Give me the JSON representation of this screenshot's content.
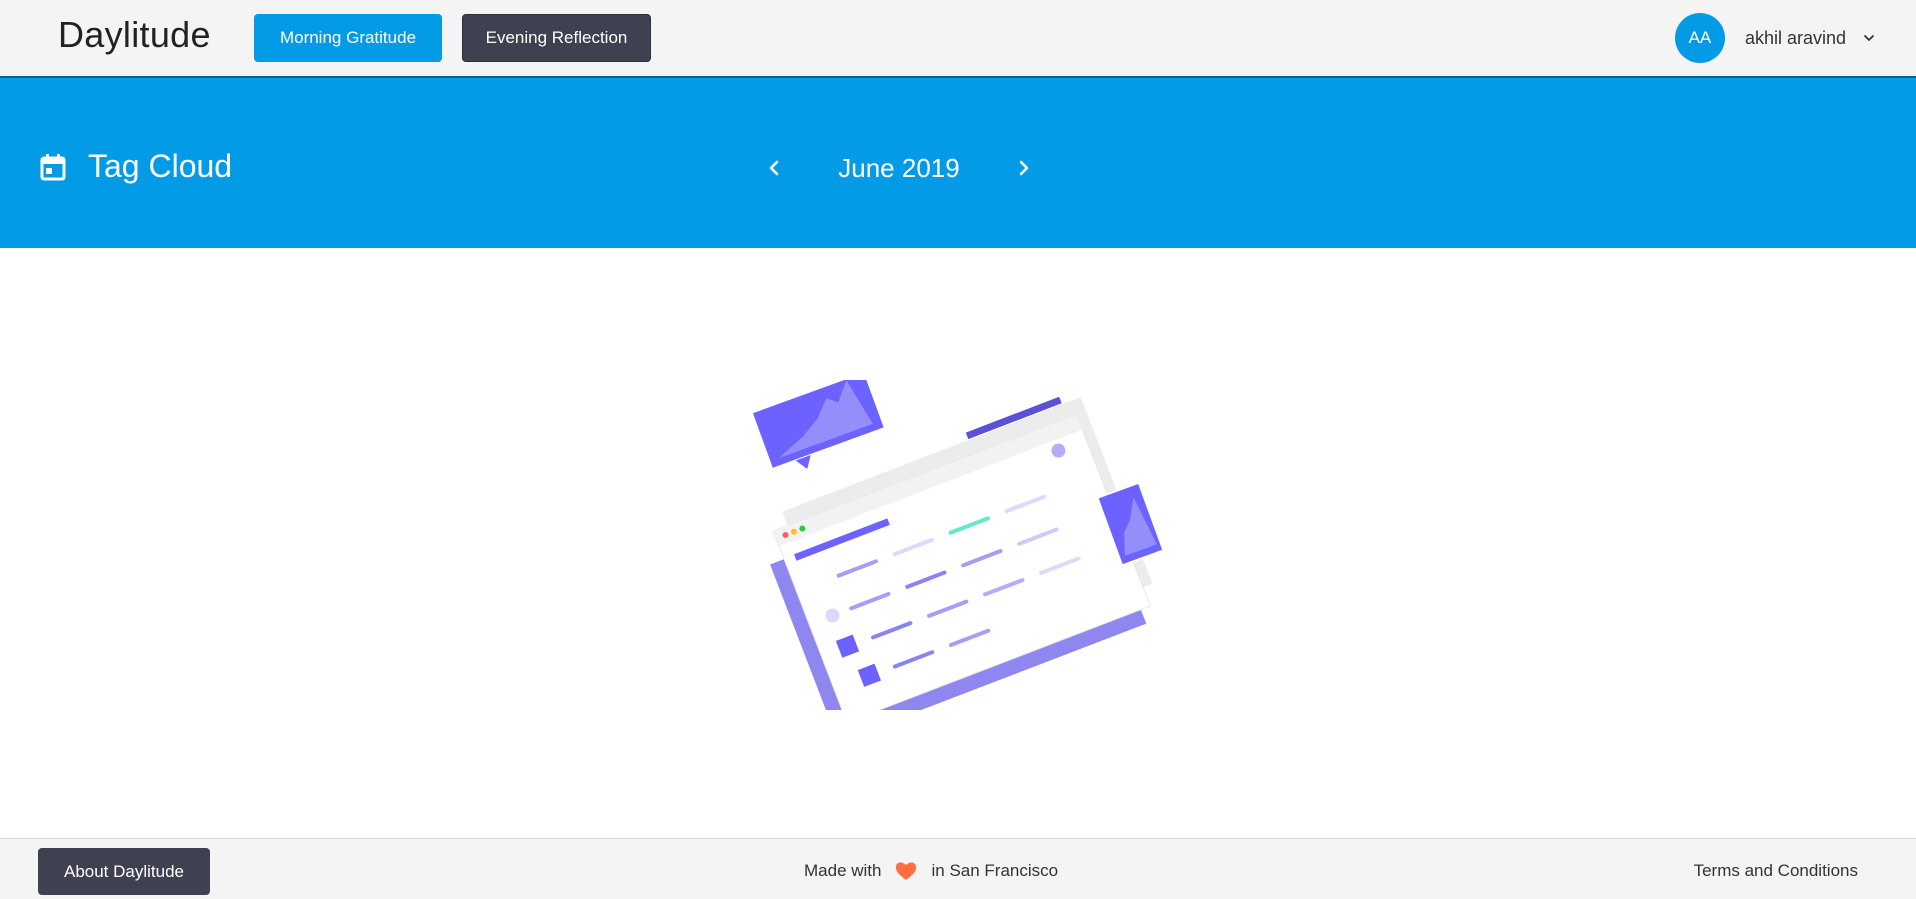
{
  "navbar": {
    "brand": "Daylitude",
    "morning_label": "Morning Gratitude",
    "evening_label": "Evening Reflection",
    "user": {
      "initials": "AA",
      "name": "akhil aravind"
    }
  },
  "header": {
    "title": "Tag Cloud",
    "month": "June 2019",
    "prev_icon": "chevron-left-icon",
    "next_icon": "chevron-right-icon"
  },
  "footer": {
    "about_label": "About Daylitude",
    "made_prefix": "Made with",
    "made_suffix": "in San Francisco",
    "terms_label": "Terms and Conditions"
  },
  "colors": {
    "primary": "#039be5",
    "dark_button": "#3f4150",
    "heart": "#ff6e40",
    "illustration": "#6c63ff"
  }
}
